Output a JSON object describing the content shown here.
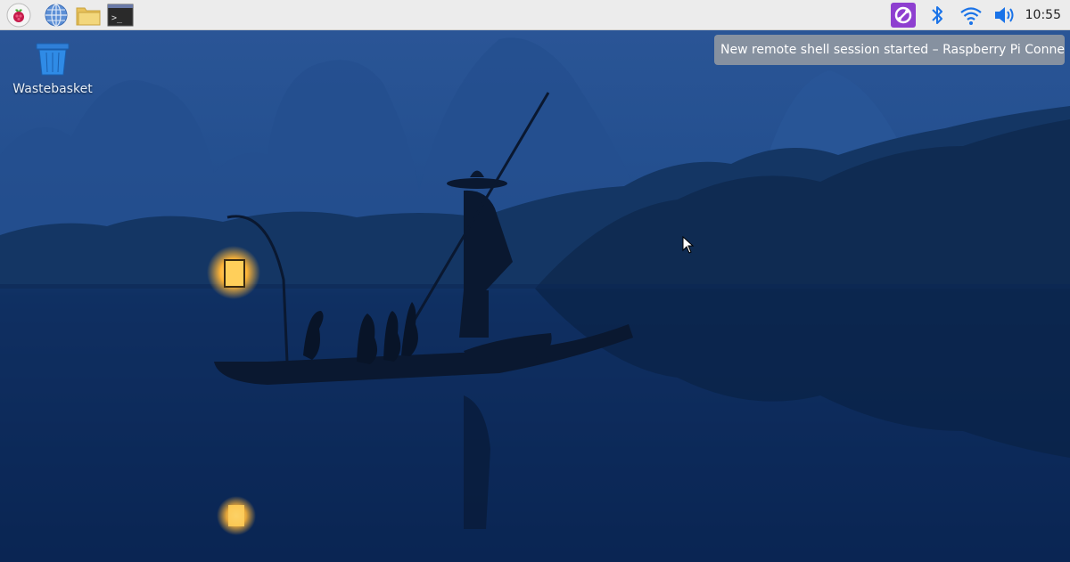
{
  "taskbar": {
    "launchers": [
      {
        "name": "raspberry-menu-icon"
      },
      {
        "name": "web-browser-icon"
      },
      {
        "name": "file-manager-icon"
      },
      {
        "name": "terminal-icon",
        "glyph": ">_"
      }
    ],
    "tray": [
      {
        "name": "rpi-connect-icon",
        "accent": "#8e3fd0"
      },
      {
        "name": "bluetooth-icon",
        "accent": "#1a73e8"
      },
      {
        "name": "wifi-icon",
        "accent": "#1a73e8"
      },
      {
        "name": "volume-icon",
        "accent": "#1a73e8"
      }
    ],
    "clock": "10:55"
  },
  "desktop": {
    "icons": [
      {
        "name": "wastebasket",
        "label": "Wastebasket"
      }
    ],
    "notification": {
      "text": "New remote shell session started – Raspberry Pi Connect"
    },
    "wallpaper": "night lake with fisherman on bamboo raft and karst mountains"
  },
  "colors": {
    "taskbar_bg": "#ececec",
    "sky": "#1b3f7a",
    "water": "#0d2a5c",
    "toast_bg": "#969ca2"
  }
}
